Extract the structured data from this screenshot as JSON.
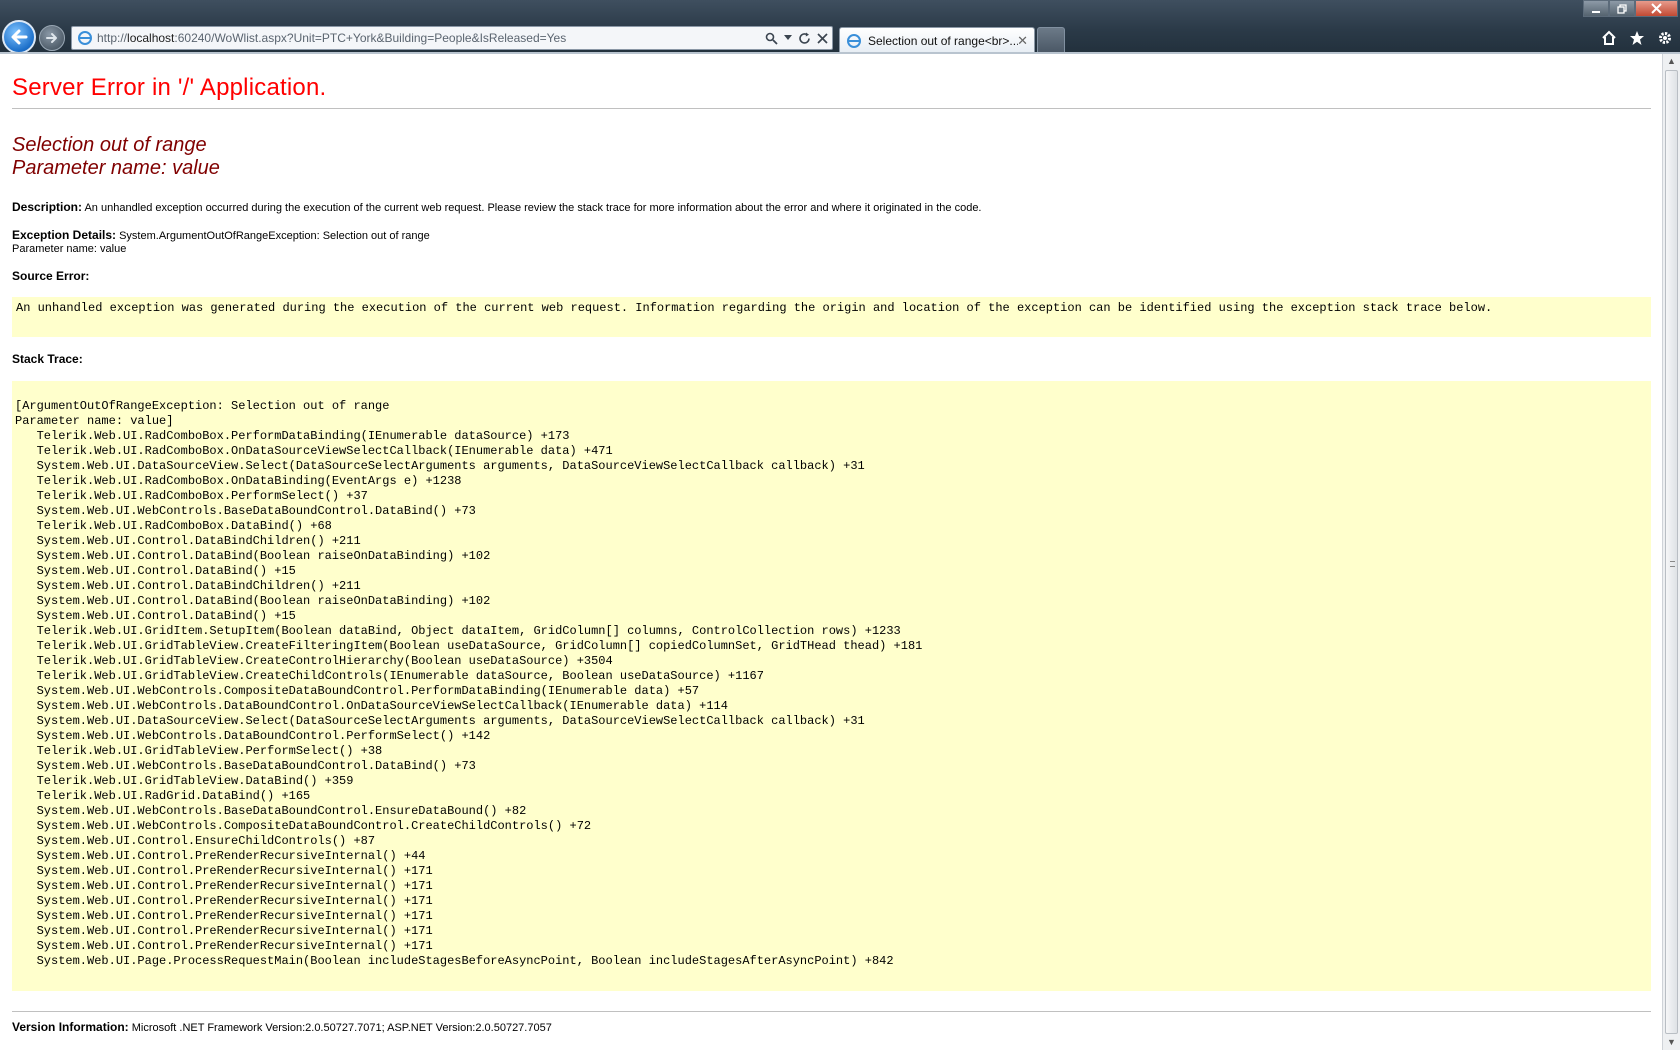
{
  "browser": {
    "url_prefix": "http://",
    "url_host": "localhost",
    "url_rest": ":60240/WoWlist.aspx?Unit=PTC+York&Building=People&IsReleased=Yes",
    "tab_title": "Selection out of range<br>...",
    "tab_close": "✕",
    "window_controls": [
      "minimize",
      "restore",
      "close"
    ],
    "toolbar_icons": [
      "home-icon",
      "favorites-star-icon",
      "tools-gear-icon"
    ]
  },
  "page": {
    "title": "Server Error in '/' Application.",
    "error_heading_line1": "Selection out of range",
    "error_heading_line2": "Parameter name: value",
    "description_label": "Description:",
    "description_text": "An unhandled exception occurred during the execution of the current web request. Please review the stack trace for more information about the error and where it originated in the code.",
    "exception_label": "Exception Details:",
    "exception_text": "System.ArgumentOutOfRangeException: Selection out of range",
    "exception_text2": "Parameter name: value",
    "source_error_label": "Source Error:",
    "source_error_text": "An unhandled exception was generated during the execution of the current web request. Information regarding the origin and location of the exception can be identified using the exception stack trace below.",
    "stack_trace_label": "Stack Trace:",
    "stack_trace": [
      "[ArgumentOutOfRangeException: Selection out of range",
      "Parameter name: value]",
      "   Telerik.Web.UI.RadComboBox.PerformDataBinding(IEnumerable dataSource) +173",
      "   Telerik.Web.UI.RadComboBox.OnDataSourceViewSelectCallback(IEnumerable data) +471",
      "   System.Web.UI.DataSourceView.Select(DataSourceSelectArguments arguments, DataSourceViewSelectCallback callback) +31",
      "   Telerik.Web.UI.RadComboBox.OnDataBinding(EventArgs e) +1238",
      "   Telerik.Web.UI.RadComboBox.PerformSelect() +37",
      "   System.Web.UI.WebControls.BaseDataBoundControl.DataBind() +73",
      "   Telerik.Web.UI.RadComboBox.DataBind() +68",
      "   System.Web.UI.Control.DataBindChildren() +211",
      "   System.Web.UI.Control.DataBind(Boolean raiseOnDataBinding) +102",
      "   System.Web.UI.Control.DataBind() +15",
      "   System.Web.UI.Control.DataBindChildren() +211",
      "   System.Web.UI.Control.DataBind(Boolean raiseOnDataBinding) +102",
      "   System.Web.UI.Control.DataBind() +15",
      "   Telerik.Web.UI.GridItem.SetupItem(Boolean dataBind, Object dataItem, GridColumn[] columns, ControlCollection rows) +1233",
      "   Telerik.Web.UI.GridTableView.CreateFilteringItem(Boolean useDataSource, GridColumn[] copiedColumnSet, GridTHead thead) +181",
      "   Telerik.Web.UI.GridTableView.CreateControlHierarchy(Boolean useDataSource) +3504",
      "   Telerik.Web.UI.GridTableView.CreateChildControls(IEnumerable dataSource, Boolean useDataSource) +1167",
      "   System.Web.UI.WebControls.CompositeDataBoundControl.PerformDataBinding(IEnumerable data) +57",
      "   System.Web.UI.WebControls.DataBoundControl.OnDataSourceViewSelectCallback(IEnumerable data) +114",
      "   System.Web.UI.DataSourceView.Select(DataSourceSelectArguments arguments, DataSourceViewSelectCallback callback) +31",
      "   System.Web.UI.WebControls.DataBoundControl.PerformSelect() +142",
      "   Telerik.Web.UI.GridTableView.PerformSelect() +38",
      "   System.Web.UI.WebControls.BaseDataBoundControl.DataBind() +73",
      "   Telerik.Web.UI.GridTableView.DataBind() +359",
      "   Telerik.Web.UI.RadGrid.DataBind() +165",
      "   System.Web.UI.WebControls.BaseDataBoundControl.EnsureDataBound() +82",
      "   System.Web.UI.WebControls.CompositeDataBoundControl.CreateChildControls() +72",
      "   System.Web.UI.Control.EnsureChildControls() +87",
      "   System.Web.UI.Control.PreRenderRecursiveInternal() +44",
      "   System.Web.UI.Control.PreRenderRecursiveInternal() +171",
      "   System.Web.UI.Control.PreRenderRecursiveInternal() +171",
      "   System.Web.UI.Control.PreRenderRecursiveInternal() +171",
      "   System.Web.UI.Control.PreRenderRecursiveInternal() +171",
      "   System.Web.UI.Control.PreRenderRecursiveInternal() +171",
      "   System.Web.UI.Control.PreRenderRecursiveInternal() +171",
      "   System.Web.UI.Page.ProcessRequestMain(Boolean includeStagesBeforeAsyncPoint, Boolean includeStagesAfterAsyncPoint) +842"
    ],
    "version_label": "Version Information:",
    "version_text": "Microsoft .NET Framework Version:2.0.50727.7071; ASP.NET Version:2.0.50727.7057"
  },
  "colors": {
    "title_red": "#ff0000",
    "heading_maroon": "#800000",
    "code_bg": "#ffffcc"
  }
}
